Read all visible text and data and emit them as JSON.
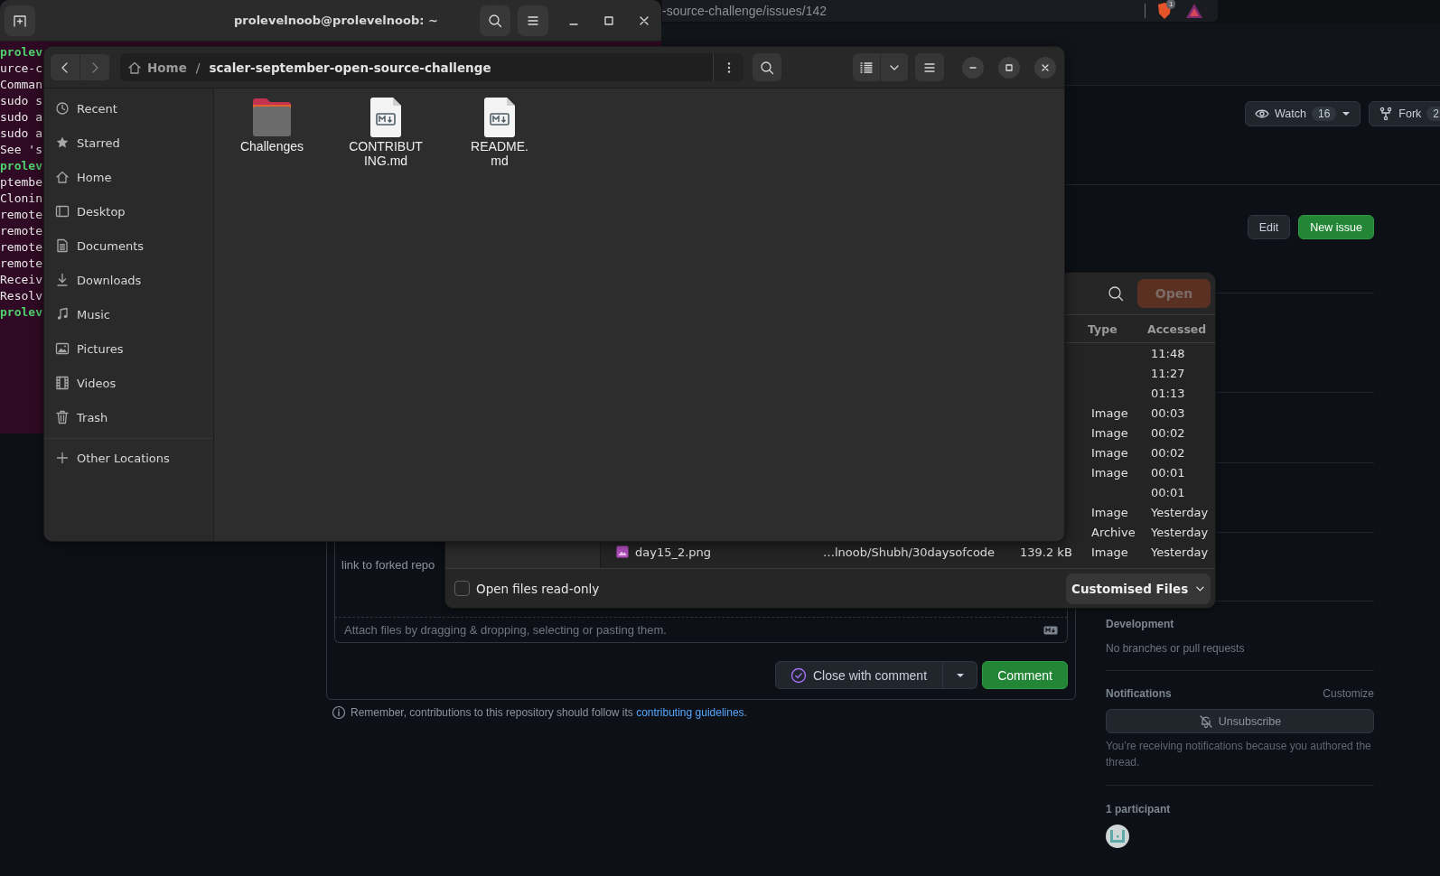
{
  "browser": {
    "url": "-source-challenge/issues/142",
    "shield_badge": "1"
  },
  "terminal": {
    "title": "prolevelnoob@prolevelnoob: ~",
    "lines": [
      {
        "kind": "prompt",
        "text": "prolev"
      },
      {
        "kind": "output",
        "text": "urce-c"
      },
      {
        "kind": "output",
        "text": "Comman"
      },
      {
        "kind": "output",
        "text": "sudo s"
      },
      {
        "kind": "output",
        "text": "sudo a"
      },
      {
        "kind": "output",
        "text": "sudo a"
      },
      {
        "kind": "output",
        "text": "See 's"
      },
      {
        "kind": "prompt",
        "text": "prolev"
      },
      {
        "kind": "output",
        "text": "ptembe"
      },
      {
        "kind": "output",
        "text": "Clonin"
      },
      {
        "kind": "output",
        "text": "remote"
      },
      {
        "kind": "output",
        "text": "remote"
      },
      {
        "kind": "output",
        "text": "remote"
      },
      {
        "kind": "output",
        "text": "remote"
      },
      {
        "kind": "output",
        "text": "Receiv"
      },
      {
        "kind": "output",
        "text": "Resolv"
      },
      {
        "kind": "prompt",
        "text": "prolev"
      }
    ]
  },
  "repo_actions": [
    {
      "kind": "watch",
      "label": "Watch",
      "count": "16"
    },
    {
      "kind": "fork",
      "label": "Fork",
      "count": "2"
    }
  ],
  "issue_actions": [
    {
      "kind": "secondary",
      "label": "Edit"
    },
    {
      "kind": "primary",
      "label": "New issue"
    }
  ],
  "comment_form": {
    "text": "link to forked repo",
    "attach_hint": "Attach files by dragging & dropping, selecting or pasting them.",
    "buttons": [
      {
        "kind": "close",
        "label": "Close with comment"
      },
      {
        "kind": "primary",
        "label": "Comment"
      }
    ],
    "note": {
      "before": "Remember, contributions to this repository should follow its ",
      "link": "contributing guidelines",
      "after": "."
    }
  },
  "sidebar": {
    "development": {
      "title": "Development",
      "text": "No branches or pull requests"
    },
    "notifications": {
      "title": "Notifications",
      "action": "Customize",
      "button": "Unsubscribe",
      "text": "You’re receiving notifications because you authored the thread."
    },
    "participants": {
      "title": "1 participant"
    }
  },
  "file_chooser": {
    "open_button": {
      "label": "Open",
      "disabled": true
    },
    "columns": [
      "Type",
      "Accessed"
    ],
    "rows": [
      {
        "accessed": "11:48"
      },
      {
        "accessed": "11:27"
      },
      {
        "accessed": "01:13"
      },
      {
        "type": "Image",
        "accessed": "00:03"
      },
      {
        "type": "Image",
        "accessed": "00:02"
      },
      {
        "type": "Image",
        "accessed": "00:02"
      },
      {
        "type": "Image",
        "accessed": "00:01"
      },
      {
        "accessed": "00:01"
      },
      {
        "type": "Image",
        "accessed": "Yesterday"
      },
      {
        "type": "Archive",
        "accessed": "Yesterday"
      },
      {
        "name": "day15_2.png",
        "path": "…lnoob/Shubh/30daysofcode",
        "size": "139.2 kB",
        "type": "Image",
        "accessed": "Yesterday"
      }
    ],
    "read_only": {
      "label": "Open files read-only",
      "checked": false
    },
    "filter": "Customised Files"
  },
  "file_manager": {
    "path": {
      "home": "Home",
      "separator": "/",
      "current": "scaler-september-open-source-challenge"
    },
    "places": [
      {
        "kind": "recent",
        "label": "Recent",
        "selected": false
      },
      {
        "kind": "starred",
        "label": "Starred",
        "selected": false
      },
      {
        "kind": "home",
        "label": "Home",
        "selected": false
      },
      {
        "kind": "desktop",
        "label": "Desktop",
        "selected": false
      },
      {
        "kind": "documents",
        "label": "Documents",
        "selected": false
      },
      {
        "kind": "downloads",
        "label": "Downloads",
        "selected": false
      },
      {
        "kind": "music",
        "label": "Music",
        "selected": false
      },
      {
        "kind": "pictures",
        "label": "Pictures",
        "selected": false
      },
      {
        "kind": "videos",
        "label": "Videos",
        "selected": false
      },
      {
        "kind": "trash",
        "label": "Trash",
        "selected": false
      }
    ],
    "other_locations": "Other Locations",
    "files": [
      {
        "kind": "folder",
        "name": "Challenges"
      },
      {
        "kind": "markdown",
        "name": "CONTRIBUTING.md"
      },
      {
        "kind": "markdown",
        "name": "README.md"
      }
    ]
  }
}
